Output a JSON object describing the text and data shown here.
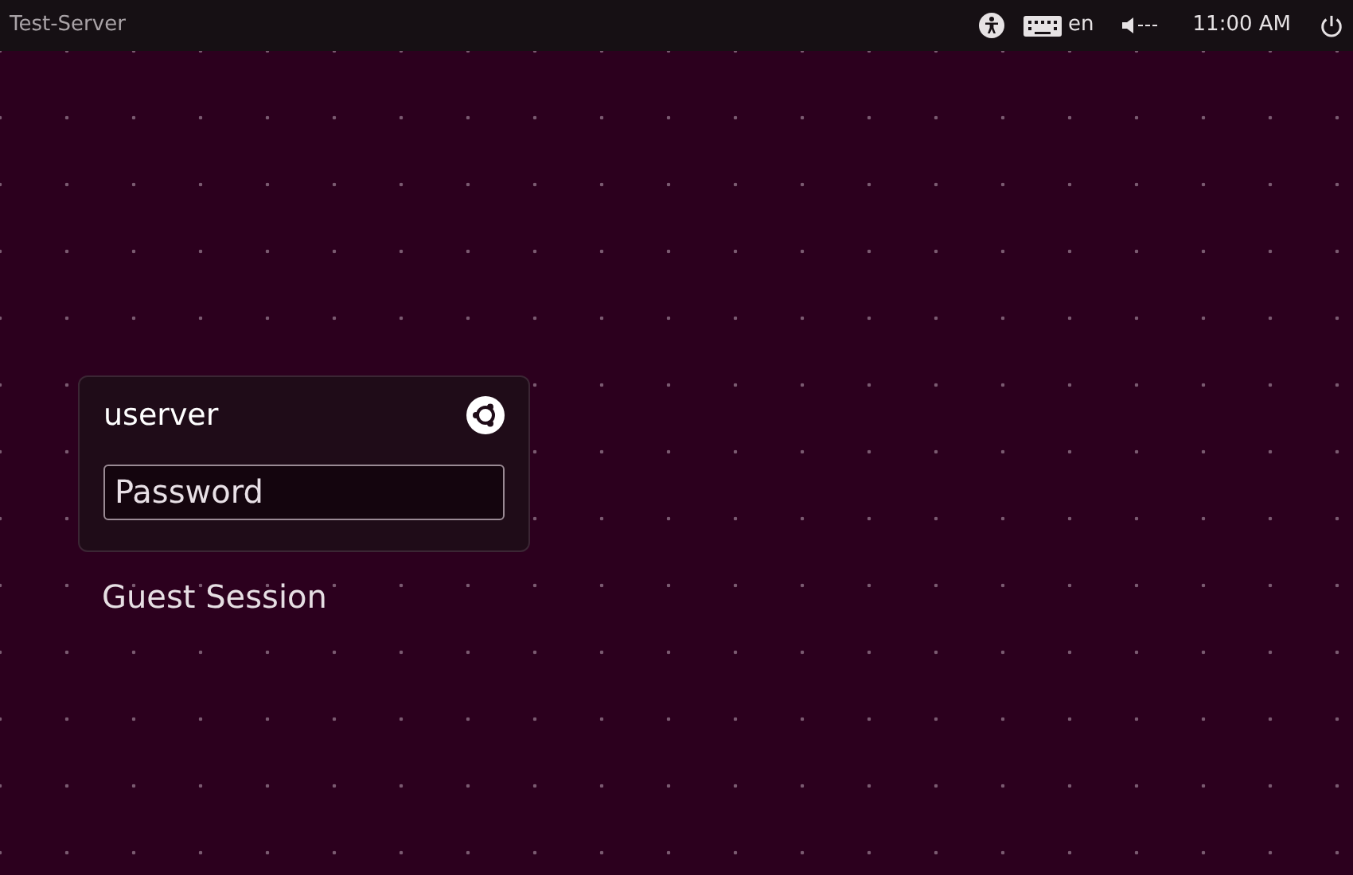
{
  "top_bar": {
    "hostname": "Test-Server",
    "keyboard_layout": "en",
    "time": "11:00 AM"
  },
  "login": {
    "username": "userver",
    "password": {
      "placeholder": "Password"
    },
    "guest_session": "Guest Session"
  }
}
